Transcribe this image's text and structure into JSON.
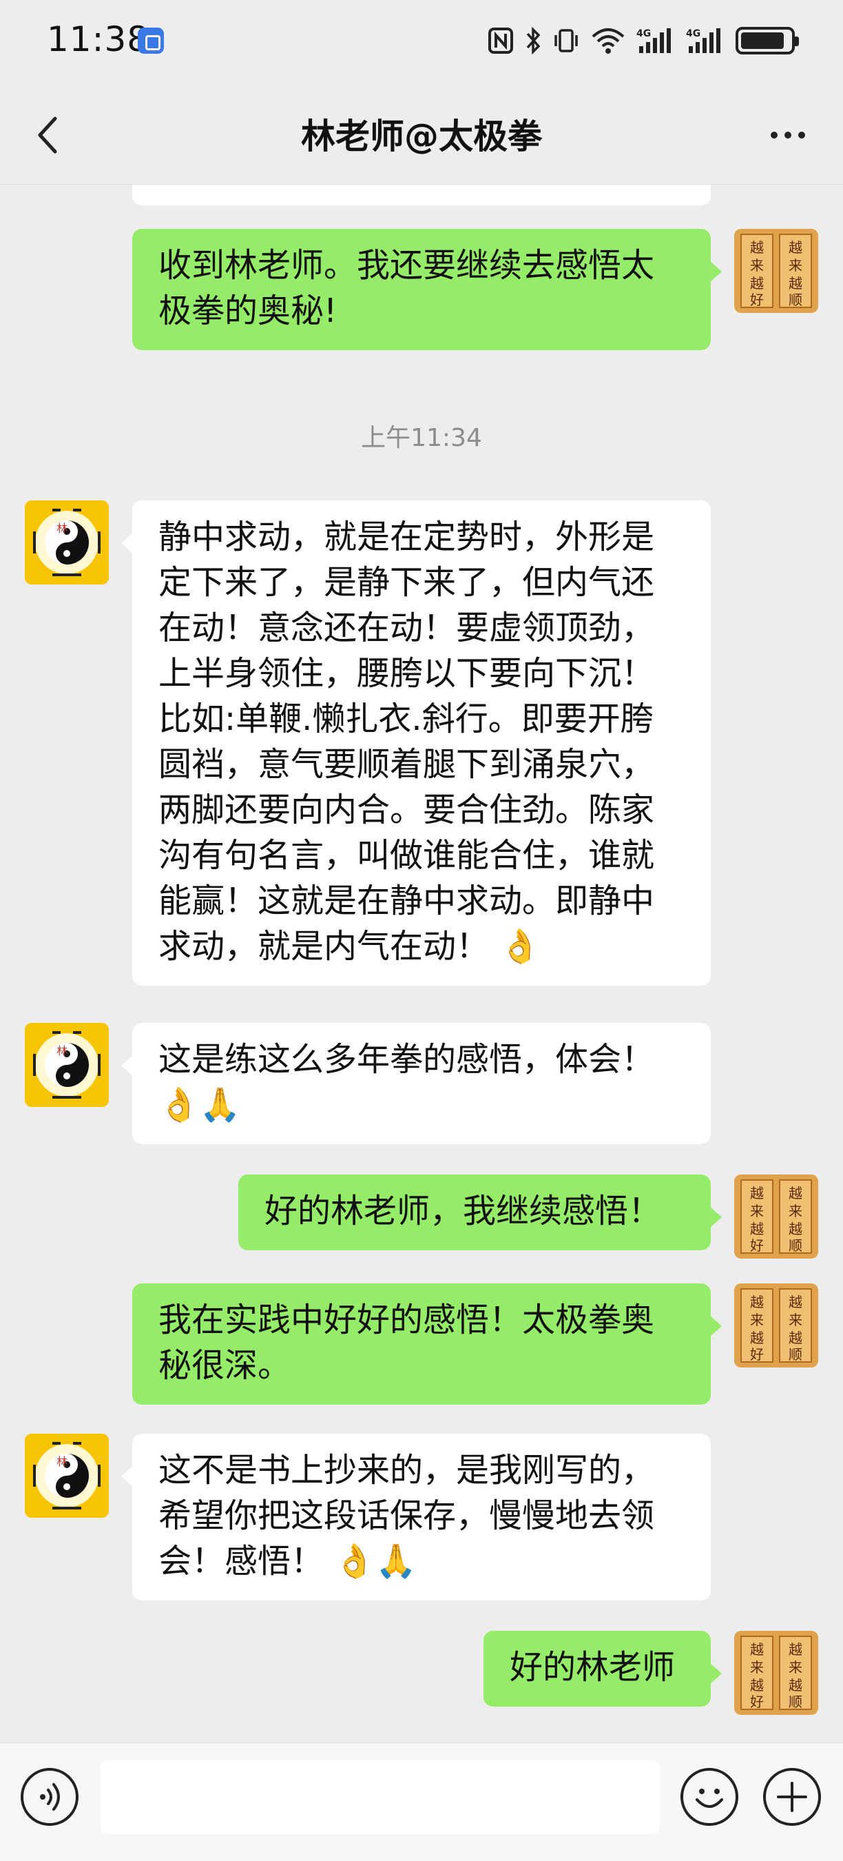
{
  "status_bar": {
    "time": "11:38",
    "icons": [
      "app-icon",
      "nfc-icon",
      "bluetooth-icon",
      "vibrate-icon",
      "wifi-icon",
      "signal-4g-icon",
      "signal-4g-icon",
      "battery-icon"
    ]
  },
  "header": {
    "title": "林老师@太极拳"
  },
  "chat": {
    "messages": [
      {
        "side": "out",
        "text": "收到林老师。我还要继续去感悟太极拳的奥秘!"
      },
      {
        "type": "time",
        "text": "上午11:34"
      },
      {
        "side": "in",
        "text": "静中求动，就是在定势时，外形是定下来了，是静下来了，但内气还在动！意念还在动！要虚领顶劲，上半身领住，腰胯以下要向下沉！比如:单鞭.懒扎衣.斜行。即要开胯圆裆，意气要顺着腿下到涌泉穴，两脚还要向内合。要合住劲。陈家沟有句名言，叫做谁能合住，谁就能赢！这就是在静中求动。即静中求动，就是内气在动！ 👌"
      },
      {
        "side": "in",
        "text": "这是练这么多年拳的感悟，体会！👌🙏"
      },
      {
        "side": "out",
        "text": "好的林老师，我继续感悟！"
      },
      {
        "side": "out",
        "text": "我在实践中好好的感悟！太极拳奥秘很深。"
      },
      {
        "side": "in",
        "text": "这不是书上抄来的，是我刚写的，希望你把这段话保存，慢慢地去领会！感悟！ 👌🙏"
      },
      {
        "side": "out",
        "text": "好的林老师"
      }
    ]
  },
  "avatars": {
    "contact": "yin-yang-avatar",
    "me_text": "越来越好 越来越顺"
  },
  "input": {
    "placeholder": ""
  },
  "colors": {
    "background": "#ededed",
    "bubble_out": "#95ec69",
    "bubble_in": "#ffffff"
  }
}
